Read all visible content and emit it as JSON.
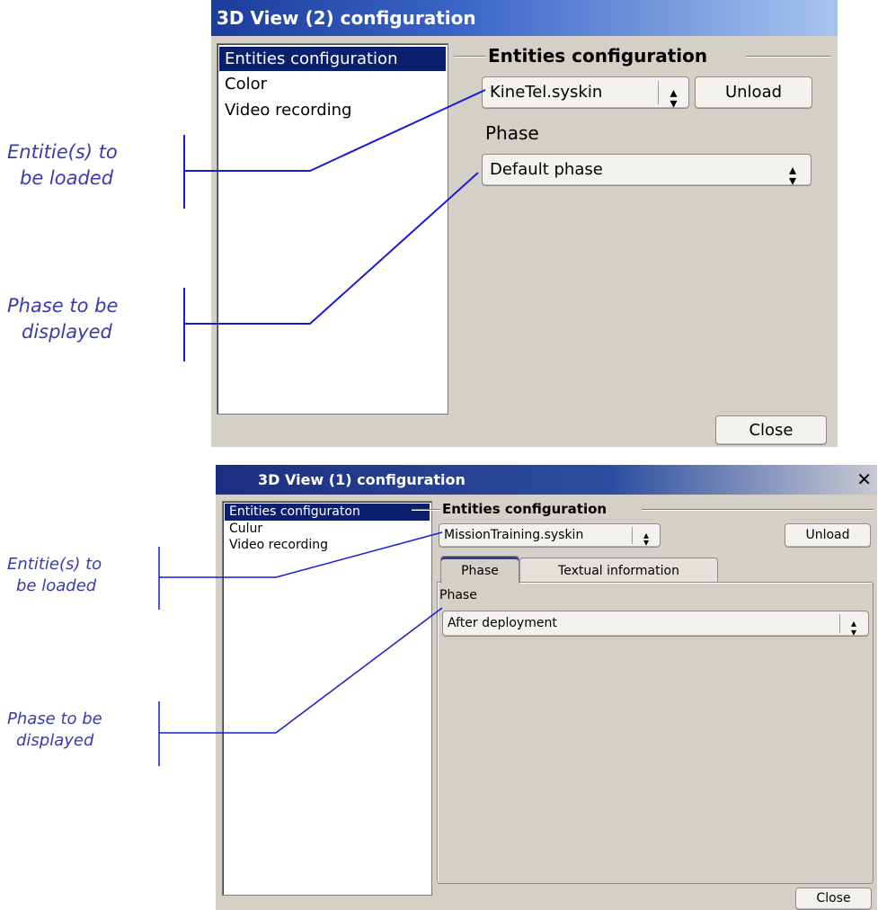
{
  "top_dialog": {
    "title": "3D View (2) configuration",
    "sidebar_items": [
      {
        "label": "Entities configuration",
        "selected": true
      },
      {
        "label": "Color",
        "selected": false
      },
      {
        "label": "Video recording",
        "selected": false
      }
    ],
    "group_title": "Entities configuration",
    "entity_select": {
      "value": "KineTel.syskin"
    },
    "unload_label": "Unload",
    "phase_label": "Phase",
    "phase_select": {
      "value": "Default phase"
    },
    "close_label": "Close"
  },
  "bottom_dialog": {
    "title": "3D View (1) configuration",
    "close_icon": "close-icon",
    "sidebar_items": [
      {
        "label": "Entities configuraton",
        "selected": true
      },
      {
        "label": "Culur",
        "selected": false
      },
      {
        "label": "Video recording",
        "selected": false
      }
    ],
    "group_title": "Entities configuration",
    "entity_select": {
      "value": "MissionTraining.syskin"
    },
    "unload_label": "Unload",
    "tabs": [
      {
        "label": "Phase",
        "active": true
      },
      {
        "label": "Textual information",
        "active": false
      }
    ],
    "phase_label": "Phase",
    "phase_select": {
      "value": "After deployment"
    },
    "close_label": "Close"
  },
  "annotations": {
    "top_entities": [
      "Entitie(s) to",
      "be loaded"
    ],
    "top_phase": [
      "Phase to be",
      "displayed"
    ],
    "bottom_entities": [
      "Entitie(s) to",
      "be loaded"
    ],
    "bottom_phase": [
      "Phase to be",
      "displayed"
    ]
  },
  "colors": {
    "annotation": "#3a3ab0",
    "annotation_line": "#1a1ad8",
    "dialog_bg": "#d4d0c8",
    "selection": "#0a1f6e"
  }
}
